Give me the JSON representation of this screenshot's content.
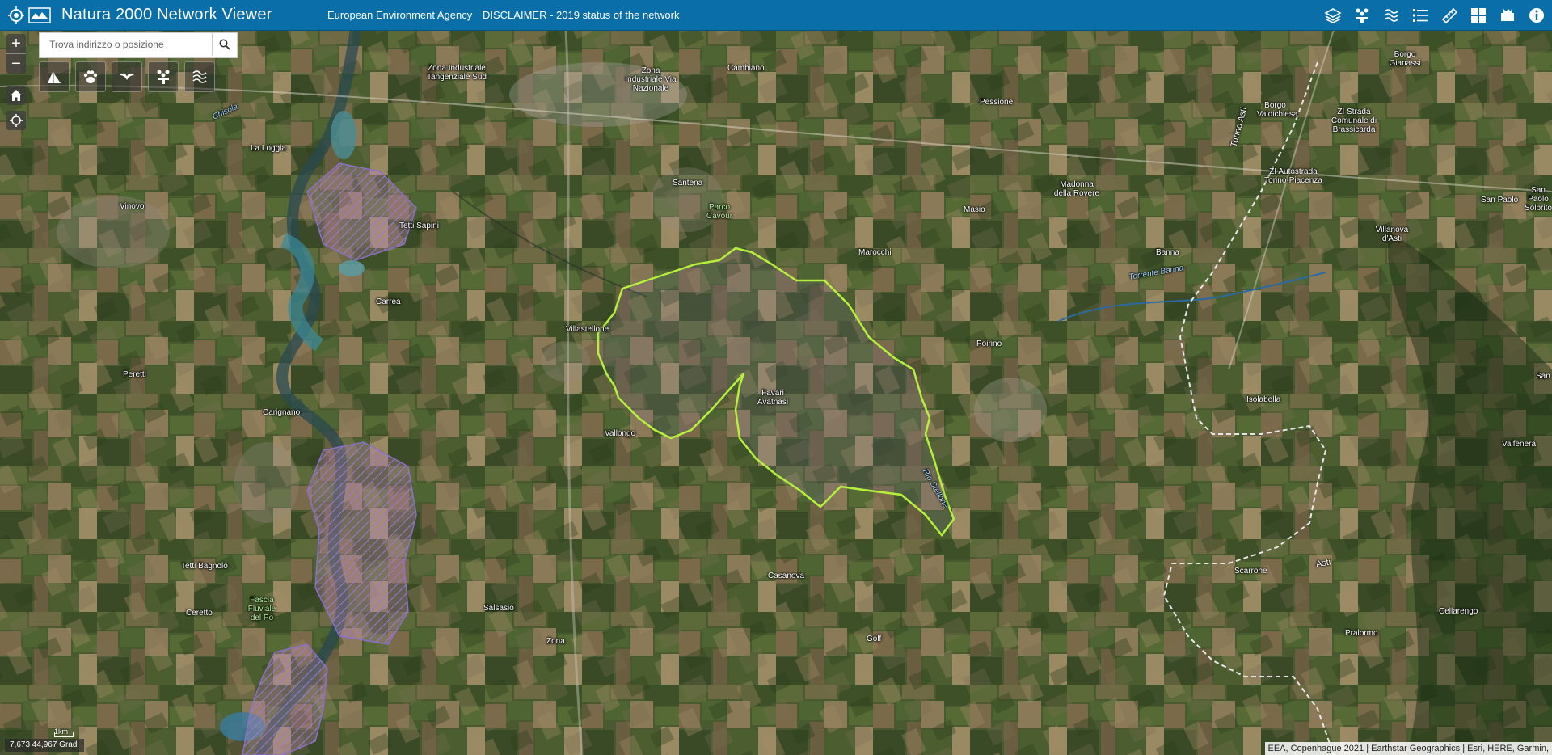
{
  "header": {
    "title": "Natura 2000 Network Viewer",
    "link_eea": "European Environment Agency",
    "link_disclaimer": "DISCLAIMER - 2019 status of the network",
    "tools": [
      "layers-icon",
      "habitats-icon",
      "waves-icon",
      "legend-icon",
      "measure-icon",
      "basemap-gallery-icon",
      "print-icon",
      "info-icon"
    ]
  },
  "map_controls": {
    "zoom_in": "+",
    "zoom_out": "−",
    "home_icon": "home-icon",
    "locate_icon": "locate-icon"
  },
  "search": {
    "placeholder": "Trova indirizzo o posizione"
  },
  "quick_layers": [
    "habitat-icon",
    "paw-icon",
    "bird-icon",
    "sites-icon",
    "waves-icon"
  ],
  "status": {
    "coordinates": "7,673 44,967 Gradi",
    "scale": "1km",
    "attribution": "EEA, Copenhague 2021 | Earthstar Geographics | Esri, HERE, Garmin,"
  },
  "map_labels": {
    "zona_industriale_sud": "Zona Industriale Tangenziale Sud",
    "zona_industriale_via": "Zona Industriale Via Nazionale",
    "cambiano": "Cambiano",
    "pessione": "Pessione",
    "borgo_gianassi": "Borgo Gianassi",
    "borgo_valdichiesa": "Borgo Valdichiesa",
    "zi_strada": "ZI Strada Comunale di Brassicarda",
    "la_loggia": "La Loggia",
    "chisola": "Chisola",
    "santena": "Santena",
    "parco_cavour": "Parco Cavour",
    "madonna_rovere": "Madonna della Rovere",
    "zi_autostrada": "ZI Autostrada Torino-Piacenza",
    "torino_asti": "Torino Asti",
    "vinovo": "Vinovo",
    "tetti_sapini": "Tetti Sapini",
    "masio": "Masio",
    "san_paolo": "San Paolo",
    "san_paolo_solbrito": "San Paolo Solbrito",
    "villanova": "Villanova d'Asti",
    "marocchi": "Marocchi",
    "banna": "Banna",
    "torrente_banna": "Torrente Banna",
    "carrea": "Carrea",
    "villastellone": "Villastellone",
    "poirino": "Poirino",
    "peretti": "Peretti",
    "favari": "Favari Avatnasi",
    "isolabella": "Isolabella",
    "carignano": "Carignano",
    "vallongo": "Vallongo",
    "rio_stellone": "Rio Stellone",
    "valfenera": "Valfenera",
    "scarrone": "Scarrone",
    "casanova": "Casanova",
    "asti": "Asti",
    "tetti_bagnolo": "Tetti Bagnolo",
    "fascia_fluviale": "Fascia Fluviale del Po",
    "ceretto": "Ceretto",
    "salsasio": "Salsasio",
    "zona": "Zona",
    "golf": "Golf",
    "cellarengo": "Cellarengo",
    "pralormo": "Pralormo",
    "san": "San"
  },
  "colors": {
    "header": "#0a6ea8",
    "site_boundary": "#b4f03c",
    "natura_hatch": "#b07fb8",
    "regional_border": "#e8e8e8"
  }
}
